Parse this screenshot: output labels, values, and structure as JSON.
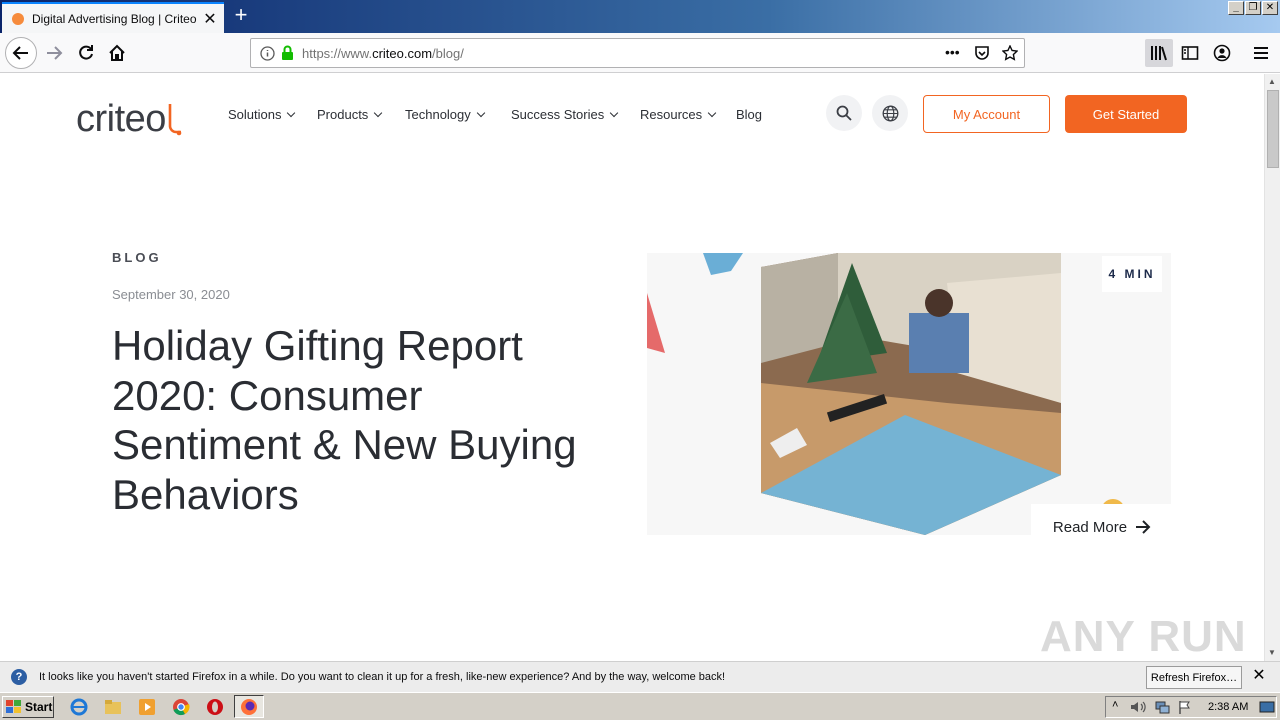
{
  "browser": {
    "tab_title": "Digital Advertising Blog | Criteo",
    "new_tab_symbol": "+",
    "url_prefix": "https://www.",
    "url_domain": "criteo.com",
    "url_path": "/blog/",
    "page_actions": "•••"
  },
  "site": {
    "logo_text": "criteo",
    "nav": [
      {
        "label": "Solutions"
      },
      {
        "label": "Products"
      },
      {
        "label": "Technology"
      },
      {
        "label": "Success Stories"
      },
      {
        "label": "Resources"
      },
      {
        "label": "Blog"
      }
    ],
    "my_account_label": "My Account",
    "get_started_label": "Get Started",
    "brand_color": "#f26522"
  },
  "post": {
    "category": "BLOG",
    "date": "September 30, 2020",
    "title": "Holiday Gifting Report 2020: Consumer Sentiment & New Buying Behaviors",
    "read_time": "4 MIN",
    "read_more_label": "Read More"
  },
  "watermark": "ANY RUN",
  "notification": {
    "message": "It looks like you haven't started Firefox in a while. Do you want to clean it up for a fresh, like-new experience? And by the way, welcome back!",
    "button_label": "Refresh Firefox…"
  },
  "taskbar": {
    "start_label": "Start",
    "clock": "2:38 AM"
  }
}
